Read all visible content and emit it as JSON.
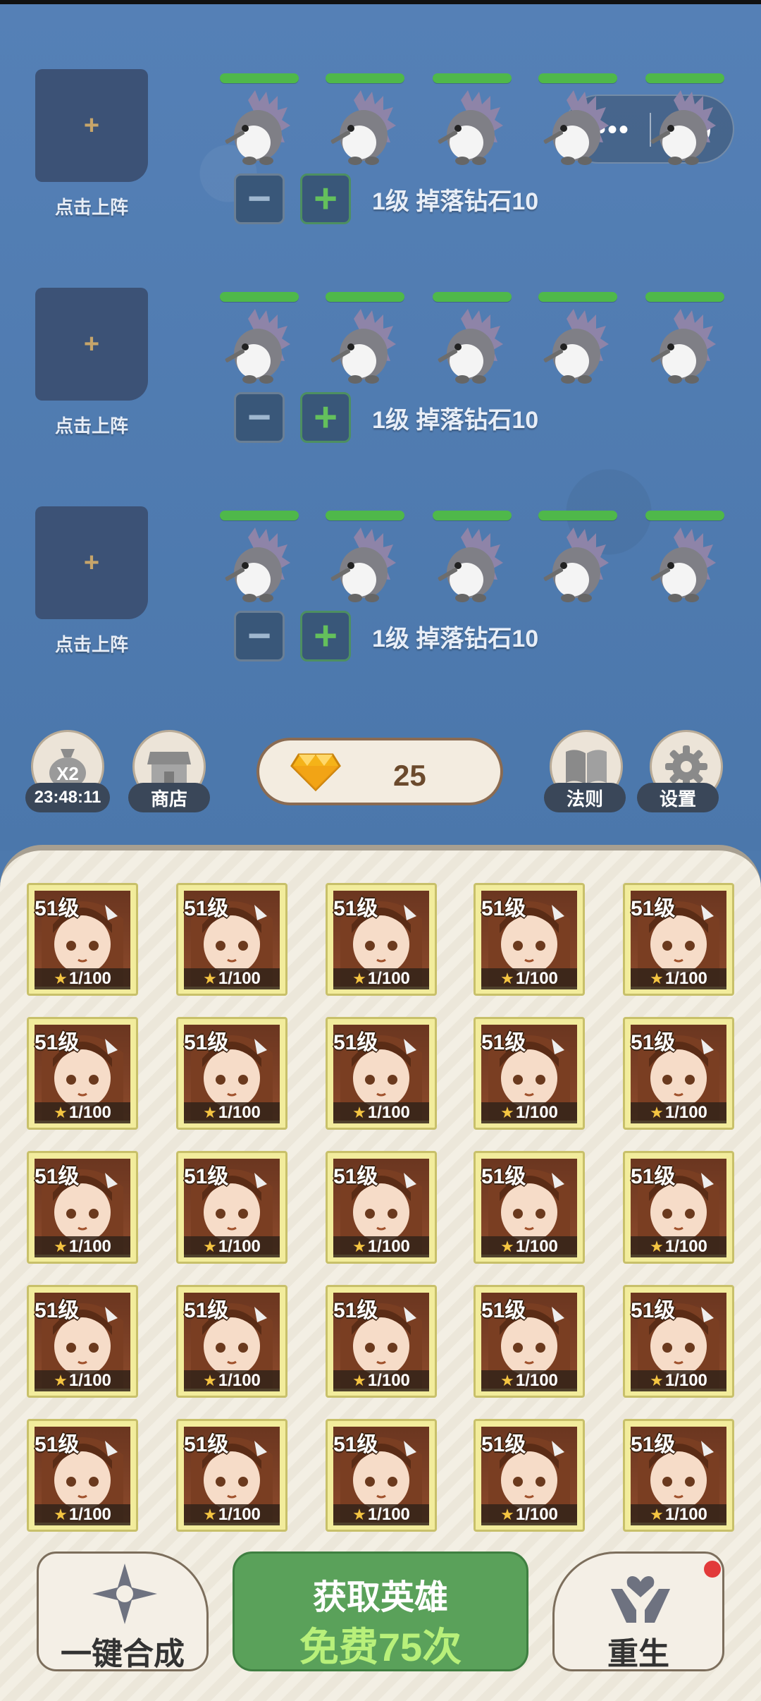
{
  "lanes": [
    {
      "slot_plus": "+",
      "slot_label": "点击上阵",
      "minus": "−",
      "plus": "+",
      "info": "1级  掉落钻石10"
    },
    {
      "slot_plus": "+",
      "slot_label": "点击上阵",
      "minus": "−",
      "plus": "+",
      "info": "1级  掉落钻石10"
    },
    {
      "slot_plus": "+",
      "slot_label": "点击上阵",
      "minus": "−",
      "plus": "+",
      "info": "1级  掉落钻石10"
    }
  ],
  "capsule": {
    "dots": "•••"
  },
  "toolbar": {
    "bag_badge": "X2",
    "timer": "23:48:11",
    "shop_label": "商店",
    "diamonds": "25",
    "rules_label": "法则",
    "settings_label": "设置"
  },
  "hero_card": {
    "level": "51级",
    "stars": "1/100"
  },
  "hero_count": 25,
  "bottom": {
    "merge_label": "一键合成",
    "get_title": "获取英雄",
    "get_sub": "免费75次",
    "rebirth_label": "重生"
  },
  "colors": {
    "hp": "#4fb84a",
    "accent_green": "#5aa15a",
    "notify": "#e23a3a"
  },
  "icons": {
    "enemy": "hedgehog-enemy-icon",
    "gem": "diamond-icon",
    "shop": "shop-icon",
    "rules": "book-icon",
    "settings": "gear-icon",
    "merge": "sparkle-icon",
    "rebirth": "heart-hands-icon"
  }
}
